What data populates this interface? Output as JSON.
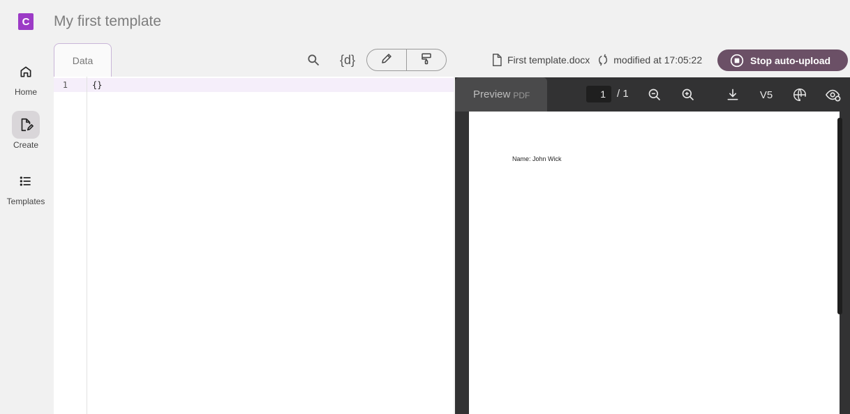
{
  "app": {
    "logo_letter": "C",
    "title": "My first template"
  },
  "nav": [
    {
      "label": "Home",
      "icon": "home-icon"
    },
    {
      "label": "Create",
      "icon": "create-document-icon",
      "active": true
    },
    {
      "label": "Templates",
      "icon": "list-icon"
    }
  ],
  "editor": {
    "tab_label": "Data",
    "line_number": "1",
    "code": "{}",
    "tools": {
      "search_icon": "search-icon",
      "variables_label": "{d}",
      "edit_icon": "pencil-icon",
      "style_icon": "paint-roller-icon"
    }
  },
  "file": {
    "name": "First template.docx",
    "status": "modified at 17:05:22",
    "stop_button_label": "Stop auto-upload"
  },
  "preview": {
    "tab_label": "Preview",
    "tab_sub": "PDF",
    "current_page": "1",
    "total_pages": "/ 1",
    "version_label": "V5",
    "content_text": "Name: John Wick"
  },
  "colors": {
    "accent": "#9c3bc6",
    "stop_button": "#6b5066",
    "preview_bg": "#323233"
  }
}
